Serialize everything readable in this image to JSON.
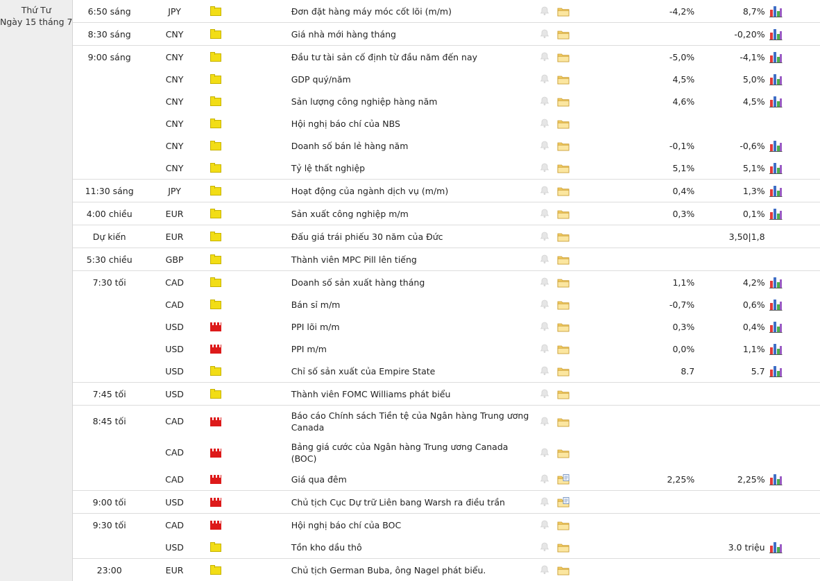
{
  "day": {
    "weekday": "Thứ Tư",
    "date": "Ngày 15 tháng 7"
  },
  "icons": {
    "low_impact": "yellow-flag-icon",
    "high_impact": "red-factory-icon",
    "alert": "bell-icon",
    "details": "folder-icon",
    "details_updated": "folder-document-icon",
    "chart": "bar-chart-icon"
  },
  "colors": {
    "low_impact": "#f2dd16",
    "high_impact": "#dd1a1a",
    "day_column_bg": "#eeeeee"
  },
  "events": [
    {
      "time": "6:50 sáng",
      "currency": "JPY",
      "impact": "low",
      "name": "Đơn đặt hàng máy móc cốt lõi (m/m)",
      "actual": "-4,2%",
      "forecast": "8,7%",
      "chart": true,
      "folder": "plain"
    },
    {
      "time": "8:30 sáng",
      "currency": "CNY",
      "impact": "low",
      "name": "Giá nhà mới hàng tháng",
      "actual": "",
      "forecast": "-0,20%",
      "chart": true,
      "folder": "plain"
    },
    {
      "time": "9:00 sáng",
      "currency": "CNY",
      "impact": "low",
      "name": "Đầu tư tài sản cố định từ đầu năm đến nay",
      "actual": "-5,0%",
      "forecast": "-4,1%",
      "chart": true,
      "folder": "plain"
    },
    {
      "time": "",
      "currency": "CNY",
      "impact": "low",
      "name": "GDP quý/năm",
      "actual": "4,5%",
      "forecast": "5,0%",
      "chart": true,
      "folder": "plain"
    },
    {
      "time": "",
      "currency": "CNY",
      "impact": "low",
      "name": "Sản lượng công nghiệp hàng năm",
      "actual": "4,6%",
      "forecast": "4,5%",
      "chart": true,
      "folder": "plain"
    },
    {
      "time": "",
      "currency": "CNY",
      "impact": "low",
      "name": "Hội nghị báo chí của NBS",
      "actual": "",
      "forecast": "",
      "chart": false,
      "folder": "plain"
    },
    {
      "time": "",
      "currency": "CNY",
      "impact": "low",
      "name": "Doanh số bán lẻ hàng năm",
      "actual": "-0,1%",
      "forecast": "-0,6%",
      "chart": true,
      "folder": "plain"
    },
    {
      "time": "",
      "currency": "CNY",
      "impact": "low",
      "name": "Tỷ lệ thất nghiệp",
      "actual": "5,1%",
      "forecast": "5,1%",
      "chart": true,
      "folder": "plain"
    },
    {
      "time": "11:30 sáng",
      "currency": "JPY",
      "impact": "low",
      "name": "Hoạt động của ngành dịch vụ (m/m)",
      "actual": "0,4%",
      "forecast": "1,3%",
      "chart": true,
      "folder": "plain"
    },
    {
      "time": "4:00 chiều",
      "currency": "EUR",
      "impact": "low",
      "name": "Sản xuất công nghiệp m/m",
      "actual": "0,3%",
      "forecast": "0,1%",
      "chart": true,
      "folder": "plain"
    },
    {
      "time": "Dự kiến",
      "currency": "EUR",
      "impact": "low",
      "name": "Đấu giá trái phiếu 30 năm của Đức",
      "actual": "",
      "forecast": "3,50|1,8",
      "chart": false,
      "folder": "plain"
    },
    {
      "time": "5:30 chiều",
      "currency": "GBP",
      "impact": "low",
      "name": "Thành viên MPC Pill lên tiếng",
      "actual": "",
      "forecast": "",
      "chart": false,
      "folder": "plain"
    },
    {
      "time": "7:30 tối",
      "currency": "CAD",
      "impact": "low",
      "name": "Doanh số sản xuất hàng tháng",
      "actual": "1,1%",
      "forecast": "4,2%",
      "chart": true,
      "folder": "plain"
    },
    {
      "time": "",
      "currency": "CAD",
      "impact": "low",
      "name": "Bán sỉ m/m",
      "actual": "-0,7%",
      "forecast": "0,6%",
      "chart": true,
      "folder": "plain"
    },
    {
      "time": "",
      "currency": "USD",
      "impact": "high",
      "name": "PPI lõi m/m",
      "actual": "0,3%",
      "forecast": "0,4%",
      "chart": true,
      "folder": "plain"
    },
    {
      "time": "",
      "currency": "USD",
      "impact": "high",
      "name": "PPI m/m",
      "actual": "0,0%",
      "forecast": "1,1%",
      "chart": true,
      "folder": "plain"
    },
    {
      "time": "",
      "currency": "USD",
      "impact": "low",
      "name": "Chỉ số sản xuất của Empire State",
      "actual": "8.7",
      "forecast": "5.7",
      "chart": true,
      "folder": "plain"
    },
    {
      "time": "7:45 tối",
      "currency": "USD",
      "impact": "low",
      "name": "Thành viên FOMC Williams phát biểu",
      "actual": "",
      "forecast": "",
      "chart": false,
      "folder": "plain"
    },
    {
      "time": "8:45 tối",
      "currency": "CAD",
      "impact": "high",
      "name": "Báo cáo Chính sách Tiền tệ của Ngân hàng Trung ương Canada",
      "actual": "",
      "forecast": "",
      "chart": false,
      "folder": "plain"
    },
    {
      "time": "",
      "currency": "CAD",
      "impact": "high",
      "name": "Bảng giá cước của Ngân hàng Trung ương Canada (BOC)",
      "actual": "",
      "forecast": "",
      "chart": false,
      "folder": "plain"
    },
    {
      "time": "",
      "currency": "CAD",
      "impact": "high",
      "name": "Giá qua đêm",
      "actual": "2,25%",
      "forecast": "2,25%",
      "chart": true,
      "folder": "doc"
    },
    {
      "time": "9:00 tối",
      "currency": "USD",
      "impact": "high",
      "name": "Chủ tịch Cục Dự trữ Liên bang Warsh ra điều trần",
      "actual": "",
      "forecast": "",
      "chart": false,
      "folder": "doc"
    },
    {
      "time": "9:30 tối",
      "currency": "CAD",
      "impact": "high",
      "name": "Hội nghị báo chí của BOC",
      "actual": "",
      "forecast": "",
      "chart": false,
      "folder": "plain"
    },
    {
      "time": "",
      "currency": "USD",
      "impact": "low",
      "name": "Tồn kho dầu thô",
      "actual": "",
      "forecast": "3.0 triệu",
      "chart": true,
      "folder": "plain"
    },
    {
      "time": "23:00",
      "currency": "EUR",
      "impact": "low",
      "name": "Chủ tịch German Buba, ông Nagel phát biểu.",
      "actual": "",
      "forecast": "",
      "chart": false,
      "folder": "plain"
    }
  ]
}
